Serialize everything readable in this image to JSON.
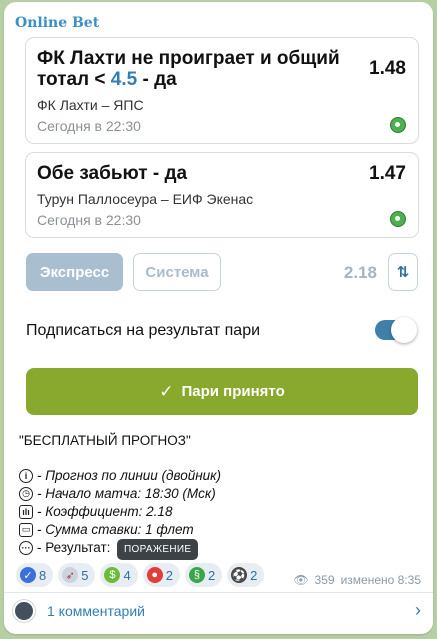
{
  "channel": {
    "name": "Online Bet"
  },
  "bets": [
    {
      "title_prefix": "ФК Лахти не проиграет и общий тотал < ",
      "title_highlight": "4.5",
      "title_suffix": " - да",
      "odds": "1.48",
      "match": "ФК Лахти – ЯПС",
      "time": "Сегодня в 22:30",
      "icon": "soccer-ball-icon"
    },
    {
      "title": "Обе забьют - да",
      "odds": "1.47",
      "match": "Турун Паллосеура – ЕИФ Экенас",
      "time": "Сегодня в 22:30",
      "icon": "soccer-ball-icon"
    }
  ],
  "tabs": {
    "express": "Экспресс",
    "system": "Система"
  },
  "total_odds": "2.18",
  "subscribe": {
    "label": "Подписаться на результат пари",
    "enabled": true
  },
  "accept_button": {
    "label": "Пари принято",
    "color": "#88a82e"
  },
  "post": {
    "heading": "\"БЕСПЛАТНЫЙ ПРОГНОЗ\"",
    "lines": [
      {
        "icon": "info-icon",
        "text": "- Прогноз по линии (двойник)"
      },
      {
        "icon": "clock-icon",
        "text": "- Начало матча: 18:30 (Мск)"
      },
      {
        "icon": "chart-icon",
        "text": "- Коэффициент: 2.18"
      },
      {
        "icon": "wallet-icon",
        "text": "- Сумма ставки: 1 флет"
      },
      {
        "icon": "dots-icon",
        "text": "- Результат:"
      }
    ],
    "result_tooltip": "ПОРАЖЕНИЕ"
  },
  "reactions": [
    {
      "icon": "check-icon",
      "count": "8",
      "color": "#3c6fd8"
    },
    {
      "icon": "rocket-icon",
      "count": "5",
      "color": "#c9d4de"
    },
    {
      "icon": "money-icon",
      "count": "4",
      "color": "#6dbb3a"
    },
    {
      "icon": "strawberry-icon",
      "count": "2",
      "color": "#e23c3c"
    },
    {
      "icon": "dragon-icon",
      "count": "2",
      "color": "#3aa54a"
    },
    {
      "icon": "soccer-icon",
      "count": "2",
      "color": "#444"
    }
  ],
  "meta": {
    "views": "359",
    "edited": "изменено 8:35"
  },
  "comments": {
    "label": "1 комментарий"
  }
}
